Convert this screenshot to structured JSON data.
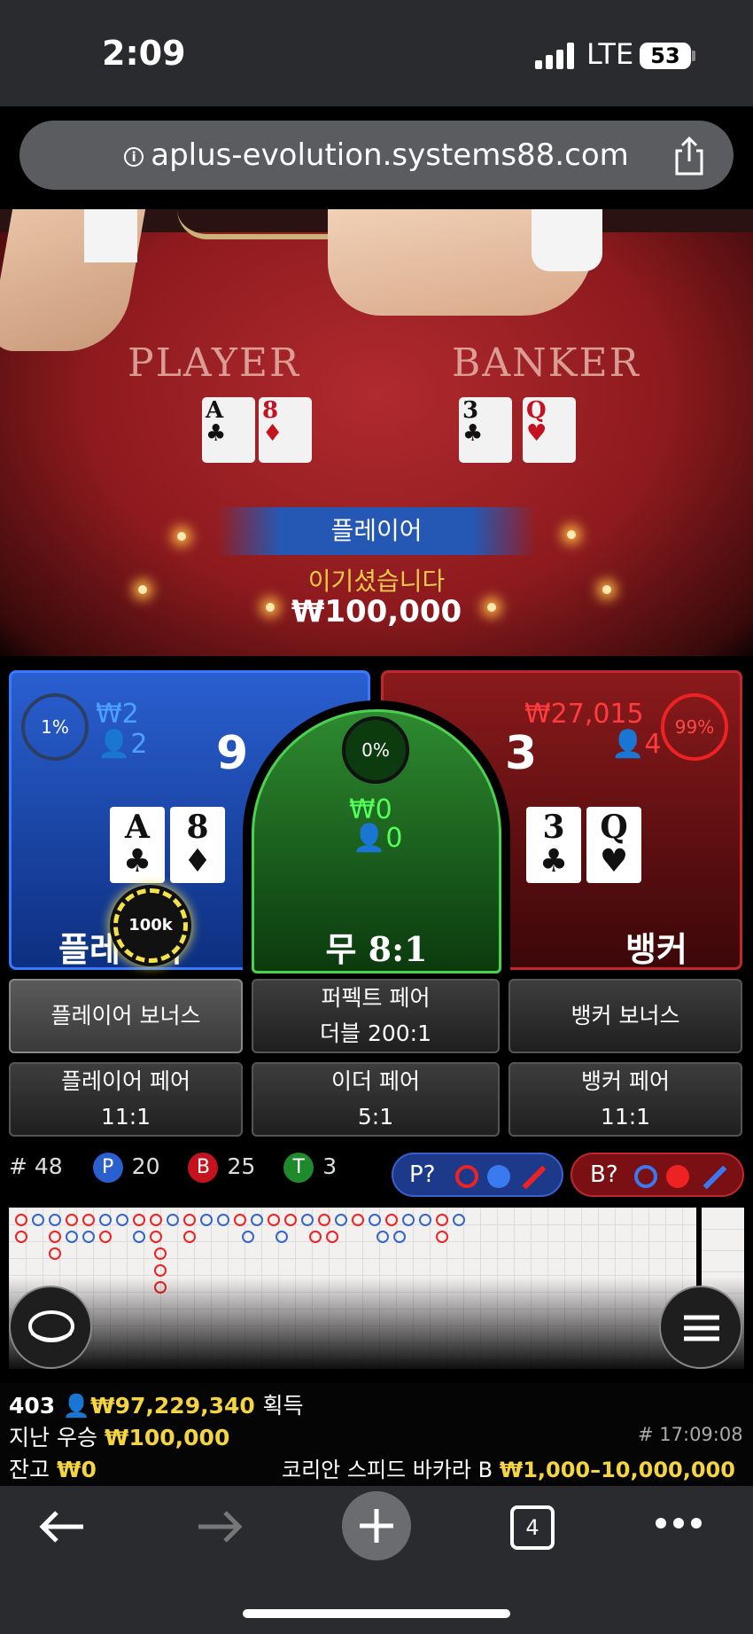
{
  "status_bar": {
    "time": "2:09",
    "network": "LTE",
    "battery": "53"
  },
  "browser": {
    "url": "aplus-evolution.systems88.com"
  },
  "table": {
    "player_label": "PLAYER",
    "banker_label": "BANKER"
  },
  "result": {
    "winner": "플레이어",
    "message": "이기셨습니다",
    "amount": "₩100,000"
  },
  "player": {
    "percent": "1%",
    "bet_total": "₩2",
    "bettors": "2",
    "score": "9",
    "cards": [
      {
        "rank": "A",
        "suit": "♣"
      },
      {
        "rank": "8",
        "suit": "♦"
      }
    ],
    "label": "플레이어",
    "chip": "100k"
  },
  "tie": {
    "percent": "0%",
    "bet_total": "₩0",
    "bettors": "0",
    "label": "무 8:1"
  },
  "banker": {
    "percent": "99%",
    "bet_total": "₩27,015",
    "bettors": "4",
    "score": "3",
    "cards": [
      {
        "rank": "3",
        "suit": "♣"
      },
      {
        "rank": "Q",
        "suit": "♥"
      }
    ],
    "label": "뱅커"
  },
  "side_bets": [
    {
      "line1": "플레이어 보너스",
      "line2": ""
    },
    {
      "line1": "퍼펙트 페어",
      "line2": "더블 200:1"
    },
    {
      "line1": "뱅커 보너스",
      "line2": ""
    },
    {
      "line1": "플레이어 페어",
      "line2": "11:1"
    },
    {
      "line1": "이더 페어",
      "line2": "5:1"
    },
    {
      "line1": "뱅커 페어",
      "line2": "11:1"
    }
  ],
  "stats": {
    "rounds": "# 48",
    "p_letter": "P",
    "p_count": "20",
    "b_letter": "B",
    "b_count": "25",
    "t_letter": "T",
    "t_count": "3",
    "p_predict": "P?",
    "b_predict": "B?"
  },
  "footer": {
    "players": "403",
    "total_won": "₩97,229,340",
    "won_label": "획득",
    "last_win_label": "지난 우승",
    "last_win": "₩100,000",
    "round_id": "# 17:09:08",
    "balance_label": "잔고",
    "balance": "₩0",
    "table_name": "코리안 스피드 바카라 B",
    "limits": "₩1,000–10,000,000"
  },
  "nav": {
    "tabs": "4"
  },
  "colors": {
    "player": "#2a5fd0",
    "banker": "#8a1a1c",
    "tie": "#2e8a30",
    "gold": "#f5d442"
  }
}
